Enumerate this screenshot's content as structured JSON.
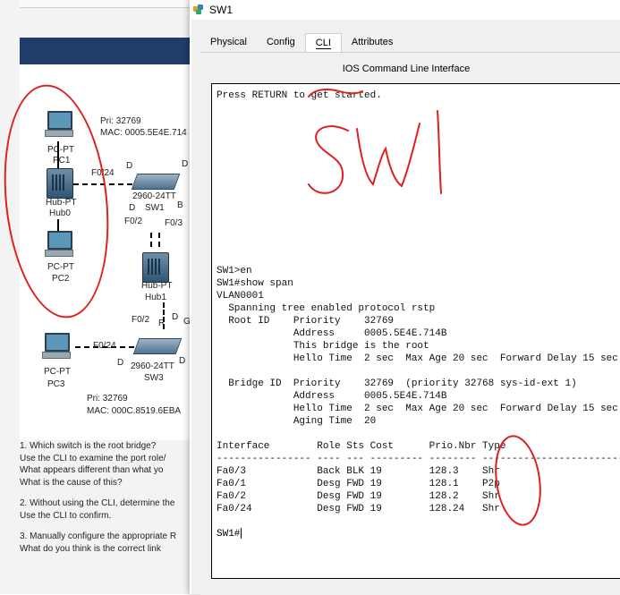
{
  "window": {
    "title": "SW1",
    "tabs": [
      {
        "label": "Physical",
        "active": false
      },
      {
        "label": "Config",
        "active": false
      },
      {
        "label": "CLI",
        "active": true
      },
      {
        "label": "Attributes",
        "active": false
      }
    ],
    "panel_title": "IOS Command Line Interface"
  },
  "terminal": {
    "lines": [
      "Press RETURN to get started.",
      "",
      "",
      "",
      "",
      "",
      "",
      "",
      "",
      "",
      "",
      "",
      "",
      "",
      "SW1>en",
      "SW1#show span",
      "VLAN0001",
      "  Spanning tree enabled protocol rstp",
      "  Root ID    Priority    32769",
      "             Address     0005.5E4E.714B",
      "             This bridge is the root",
      "             Hello Time  2 sec  Max Age 20 sec  Forward Delay 15 sec",
      "",
      "  Bridge ID  Priority    32769  (priority 32768 sys-id-ext 1)",
      "             Address     0005.5E4E.714B",
      "             Hello Time  2 sec  Max Age 20 sec  Forward Delay 15 sec",
      "             Aging Time  20",
      "",
      "Interface        Role Sts Cost      Prio.Nbr Type",
      "---------------- ---- --- --------- -------- --------------------------------",
      "Fa0/3            Back BLK 19        128.3    Shr",
      "Fa0/1            Desg FWD 19        128.1    P2p",
      "Fa0/2            Desg FWD 19        128.2    Shr",
      "Fa0/24           Desg FWD 19        128.24   Shr",
      ""
    ],
    "prompt": "SW1#",
    "annotation": "SW1"
  },
  "topology": {
    "sw1_info": {
      "pri": "Pri: 32769",
      "mac": "MAC: 0005.5E4E.714"
    },
    "sw3_info": {
      "pri": "Pri: 32769",
      "mac": "MAC: 000C.8519.6EBA"
    },
    "devices": {
      "pc1_type": "PC-PT",
      "pc1_name": "PC1",
      "pc2_type": "PC-PT",
      "pc2_name": "PC2",
      "pc3_type": "PC-PT",
      "pc3_name": "PC3",
      "hub0_type": "Hub-PT",
      "hub0_name": "Hub0",
      "hub1_type": "Hub-PT",
      "hub1_name": "Hub1",
      "sw1_type": "2960-24TT",
      "sw1_name": "SW1",
      "sw3_type": "2960-24TT",
      "sw3_name": "SW3"
    },
    "ports": {
      "hub0_sw1": "F0/24",
      "sw1_p2": "F0/2",
      "sw1_p3": "F0/3",
      "hub1_sw3": "F0/2",
      "pc3_sw3": "F0/24"
    },
    "state_letters": {
      "d1": "D",
      "d2": "D",
      "d3": "D",
      "b1": "B",
      "r1": "R",
      "d4": "D",
      "g1": "G",
      "d5": "D",
      "d6": "D"
    }
  },
  "questions": [
    [
      "1. Which switch is the root bridge?",
      "    Use the CLI to examine the port role/",
      "    What appears different than what yo",
      "    What is the cause of this?"
    ],
    [
      "2. Without using the CLI, determine the",
      "    Use the CLI to confirm."
    ],
    [
      "3. Manually configure the appropriate R",
      "    What do you think is the correct link"
    ]
  ],
  "colors": {
    "annotation": "#e02020",
    "banner": "#1f3c6b"
  }
}
